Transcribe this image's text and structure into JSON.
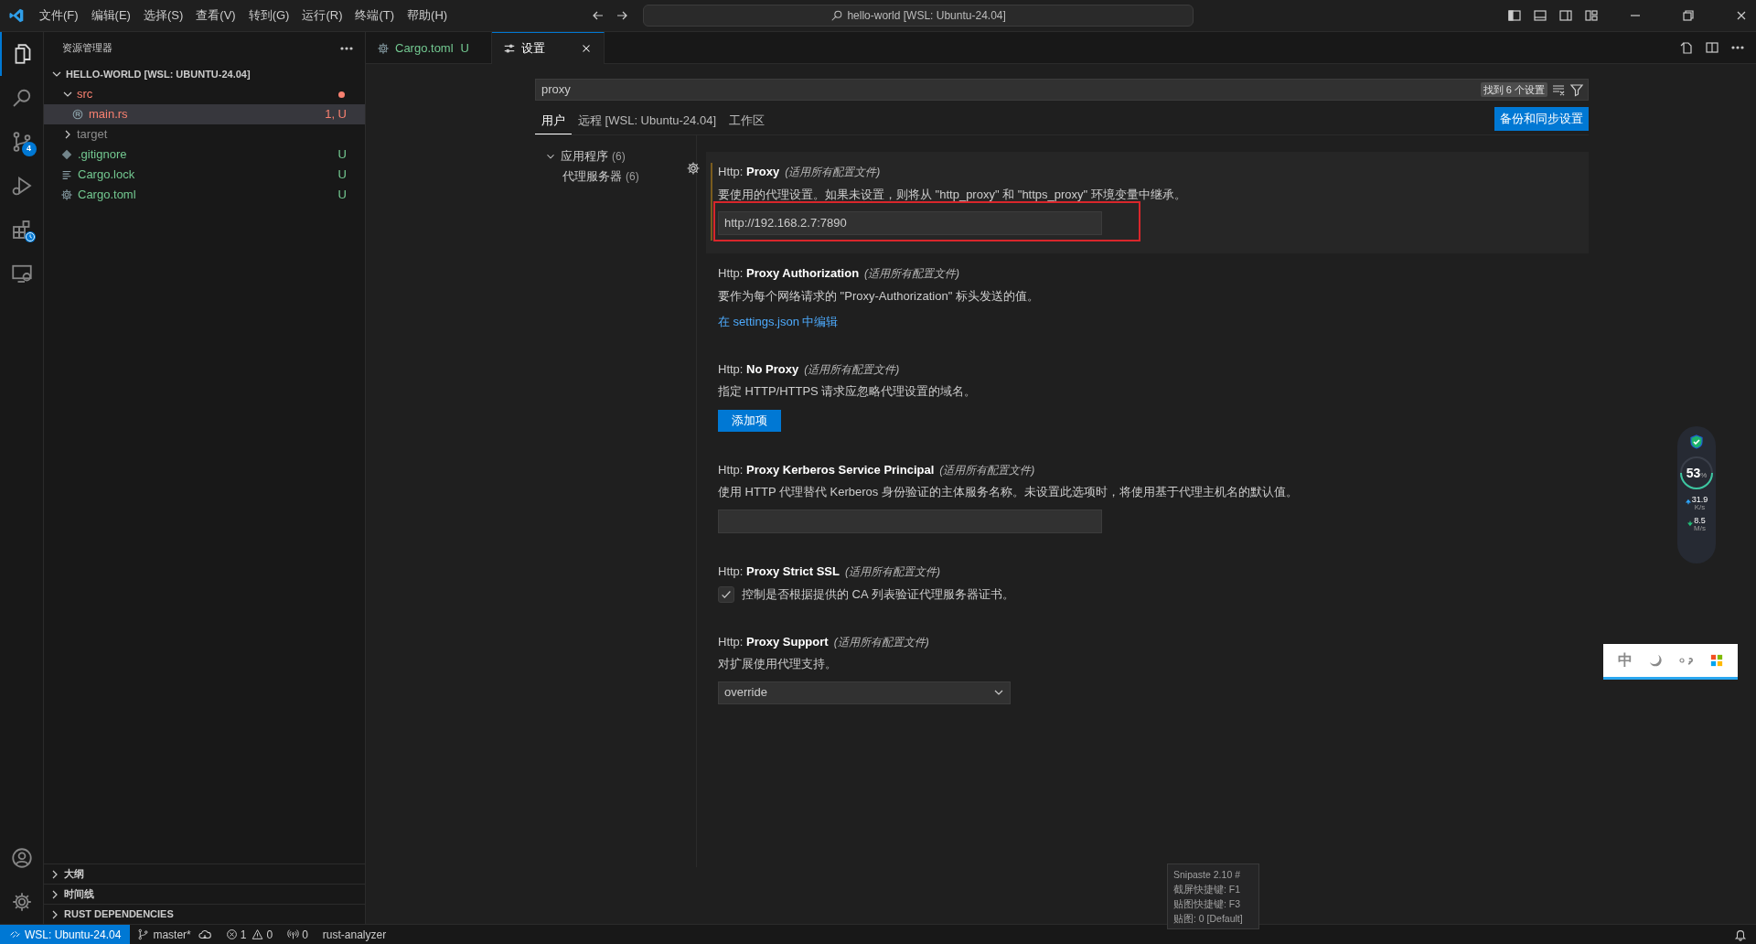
{
  "menu": [
    "文件(F)",
    "编辑(E)",
    "选择(S)",
    "查看(V)",
    "转到(G)",
    "运行(R)",
    "终端(T)",
    "帮助(H)"
  ],
  "command_center": "hello-world [WSL: Ubuntu-24.04]",
  "activity_bar": {
    "scm_badge": "4"
  },
  "explorer": {
    "title": "资源管理器",
    "tree": [
      {
        "label": "HELLO-WORLD [WSL: UBUNTU-24.04]",
        "kind": "root",
        "expanded": true,
        "children": [
          {
            "label": "src",
            "kind": "folder",
            "color": "#f88070",
            "expanded": true,
            "children": [
              {
                "label": "main.rs",
                "kind": "rust",
                "badge": "1, U",
                "selected": true
              }
            ]
          },
          {
            "label": "target",
            "kind": "folder",
            "color": "#8c8c8c",
            "expanded": false
          },
          {
            "label": ".gitignore",
            "kind": "git",
            "color": "#73c991",
            "badge": "U",
            "selected": false
          },
          {
            "label": "Cargo.lock",
            "kind": "lines",
            "color": "#73c991",
            "badge": "U",
            "selected": false
          },
          {
            "label": "Cargo.toml",
            "kind": "gear",
            "color": "#73c991",
            "badge": "U",
            "selected": false
          }
        ]
      }
    ],
    "sections": [
      {
        "label": "大纲",
        "expanded": false
      },
      {
        "label": "时间线",
        "expanded": false
      },
      {
        "label": "RUST DEPENDENCIES",
        "expanded": false
      }
    ]
  },
  "tabs": [
    {
      "label": "Cargo.toml",
      "badge": "U",
      "kind": "gear",
      "selected": false
    },
    {
      "label": "设置",
      "kind": "settings",
      "selected": true
    }
  ],
  "settings": {
    "search": {
      "value": "proxy",
      "result_count": "找到 6 个设置"
    },
    "scopes": [
      {
        "label": "用户",
        "selected": true
      },
      {
        "label": "远程 [WSL: Ubuntu-24.04]",
        "selected": false
      },
      {
        "label": "工作区",
        "selected": false
      }
    ],
    "sync_button": "备份和同步设置",
    "toc": [
      {
        "label": "应用程序",
        "count": "(6)",
        "expanded": true,
        "children": [
          {
            "label": "代理服务器",
            "count": "(6)"
          }
        ]
      }
    ],
    "items": [
      {
        "category": "Http: ",
        "name": "Proxy",
        "scope": "(适用所有配置文件)",
        "description": "要使用的代理设置。如果未设置，则将从 \"http_proxy\" 和 \"https_proxy\" 环境变量中继承。",
        "kind": "text",
        "value": "http://192.168.2.7:7890",
        "focused": true
      },
      {
        "category": "Http: ",
        "name": "Proxy Authorization",
        "scope": "(适用所有配置文件)",
        "description": "要作为每个网络请求的 \"Proxy-Authorization\" 标头发送的值。",
        "kind": "link",
        "link": "在 settings.json 中编辑",
        "focused": false
      },
      {
        "category": "Http: ",
        "name": "No Proxy",
        "scope": "(适用所有配置文件)",
        "description": "指定 HTTP/HTTPS 请求应忽略代理设置的域名。",
        "kind": "button",
        "button": "添加项",
        "focused": false
      },
      {
        "category": "Http: ",
        "name": "Proxy Kerberos Service Principal",
        "scope": "(适用所有配置文件)",
        "description": "使用 HTTP 代理替代 Kerberos 身份验证的主体服务名称。未设置此选项时，将使用基于代理主机名的默认值。",
        "kind": "text",
        "focused": false
      },
      {
        "category": "Http: ",
        "name": "Proxy Strict SSL",
        "scope": "(适用所有配置文件)",
        "description": "控制是否根据提供的 CA 列表验证代理服务器证书。",
        "kind": "checkbox",
        "checked": true,
        "focused": false
      },
      {
        "category": "Http: ",
        "name": "Proxy Support",
        "scope": "(适用所有配置文件)",
        "description": "对扩展使用代理支持。",
        "kind": "dropdown",
        "value": "override",
        "focused": false
      }
    ]
  },
  "net_monitor": {
    "percent": "53",
    "unit": "%",
    "up": "31.9",
    "up_unit": "K/s",
    "down": "8.5",
    "down_unit": "M/s"
  },
  "ime_bar": {
    "mode": "中"
  },
  "snipaste_tip": [
    "Snipaste 2.10 #",
    "截屏快捷键: F1",
    "贴图快捷键: F3",
    "贴图: 0 [Default]"
  ],
  "status_bar": {
    "remote": "WSL: Ubuntu-24.04",
    "branch": "master*",
    "errors": "1",
    "warnings": "0",
    "ports": "0",
    "extension": "rust-analyzer"
  }
}
